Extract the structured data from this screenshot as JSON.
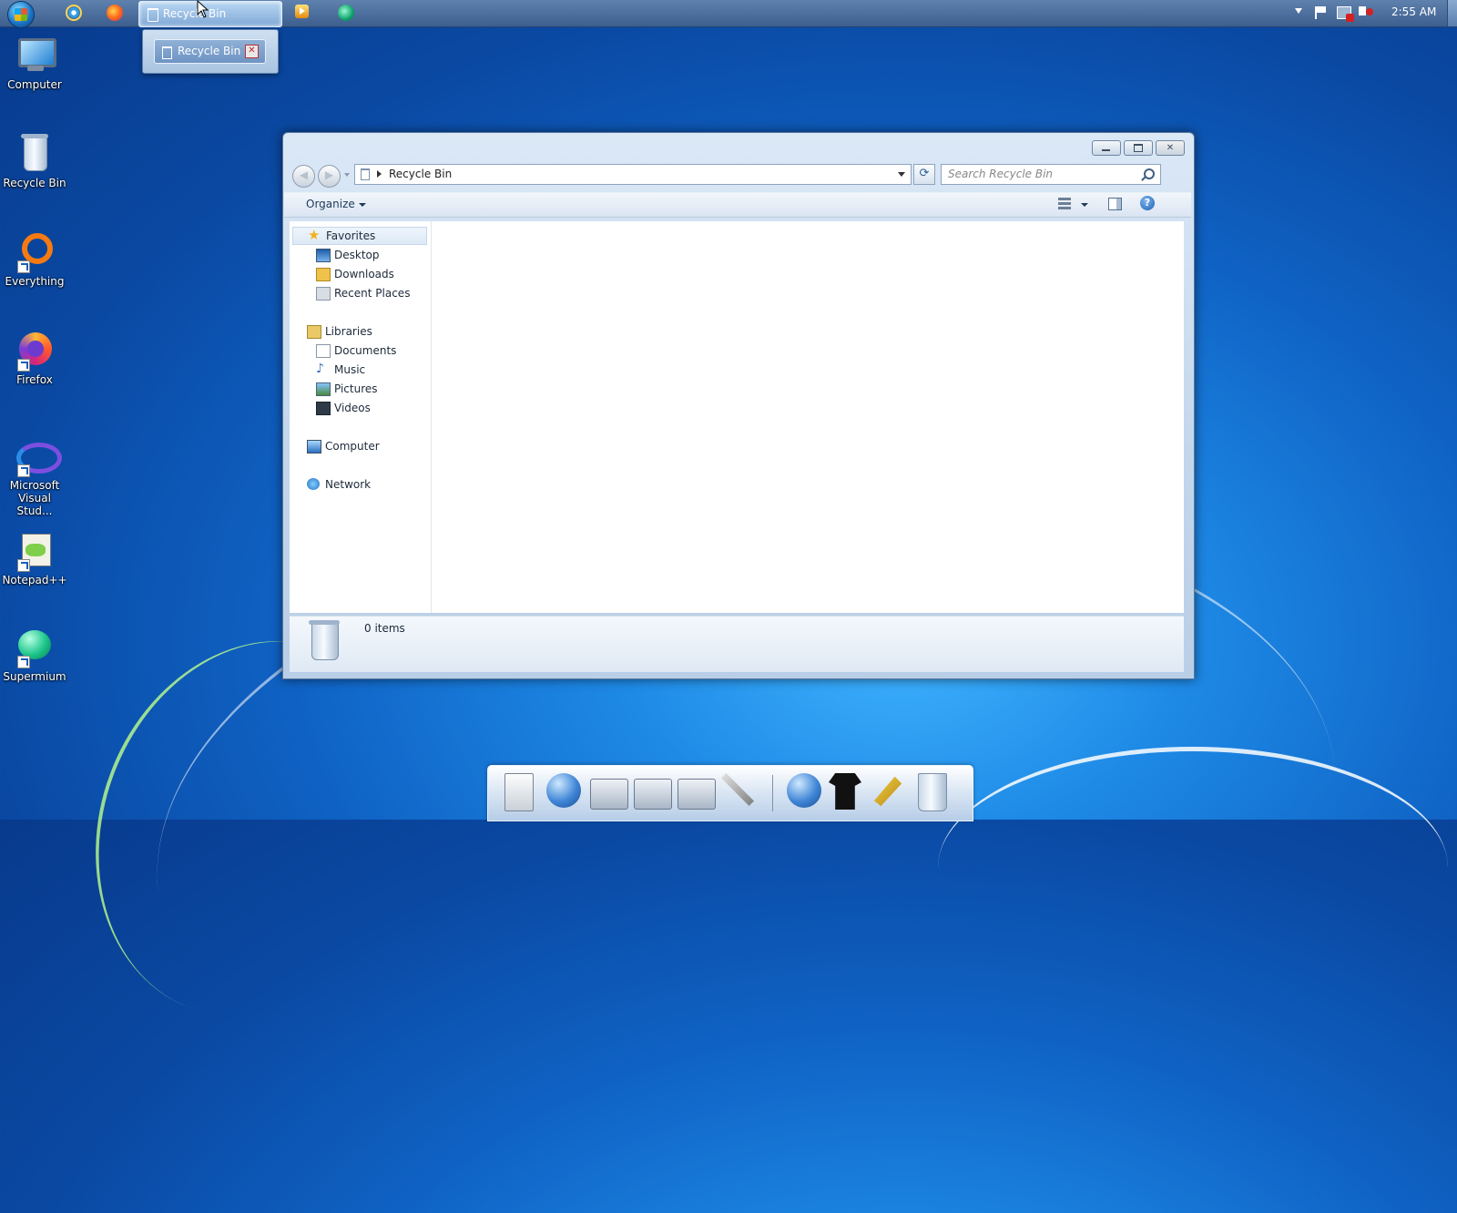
{
  "taskbar": {
    "active_task_label": "Recycle Bin",
    "clock": "2:55 AM",
    "pinned_icons": [
      "internet-explorer-icon",
      "firefox-icon",
      "media-player-icon",
      "supermium-icon"
    ]
  },
  "thumbnail": {
    "label": "Recycle Bin",
    "close_glyph": "✕"
  },
  "desktop": {
    "icons": [
      {
        "label": "Computer",
        "icon": "computer-icon"
      },
      {
        "label": "Recycle Bin",
        "icon": "recycle-bin-icon"
      },
      {
        "label": "Everything",
        "icon": "everything-icon"
      },
      {
        "label": "Firefox",
        "icon": "firefox-icon"
      },
      {
        "label": "Microsoft Visual Stud...",
        "icon": "visual-studio-icon"
      },
      {
        "label": "Notepad++",
        "icon": "notepad-plus-plus-icon"
      },
      {
        "label": "Supermium",
        "icon": "supermium-icon"
      }
    ]
  },
  "explorer": {
    "address_path": "Recycle Bin",
    "search_placeholder": "Search Recycle Bin",
    "toolbar": {
      "organize_label": "Organize"
    },
    "nav": {
      "favorites": {
        "label": "Favorites",
        "items": [
          "Desktop",
          "Downloads",
          "Recent Places"
        ]
      },
      "libraries": {
        "label": "Libraries",
        "items": [
          "Documents",
          "Music",
          "Pictures",
          "Videos"
        ]
      },
      "computer": "Computer",
      "network": "Network"
    },
    "status": {
      "item_count": "0 items"
    }
  },
  "dock": {
    "items": [
      "document-icon",
      "network-globe-icon",
      "files-folder-icon",
      "open-folder-icon",
      "pictures-folder-icon",
      "tools-icon",
      "internet-globe-icon",
      "tshirt-icon",
      "wrench-icon",
      "recycle-bin-icon"
    ]
  },
  "colors": {
    "desktop_blue": "#0f62c4",
    "taskbar": "#4a6c9a",
    "window_chrome": "#c2d6ec"
  }
}
